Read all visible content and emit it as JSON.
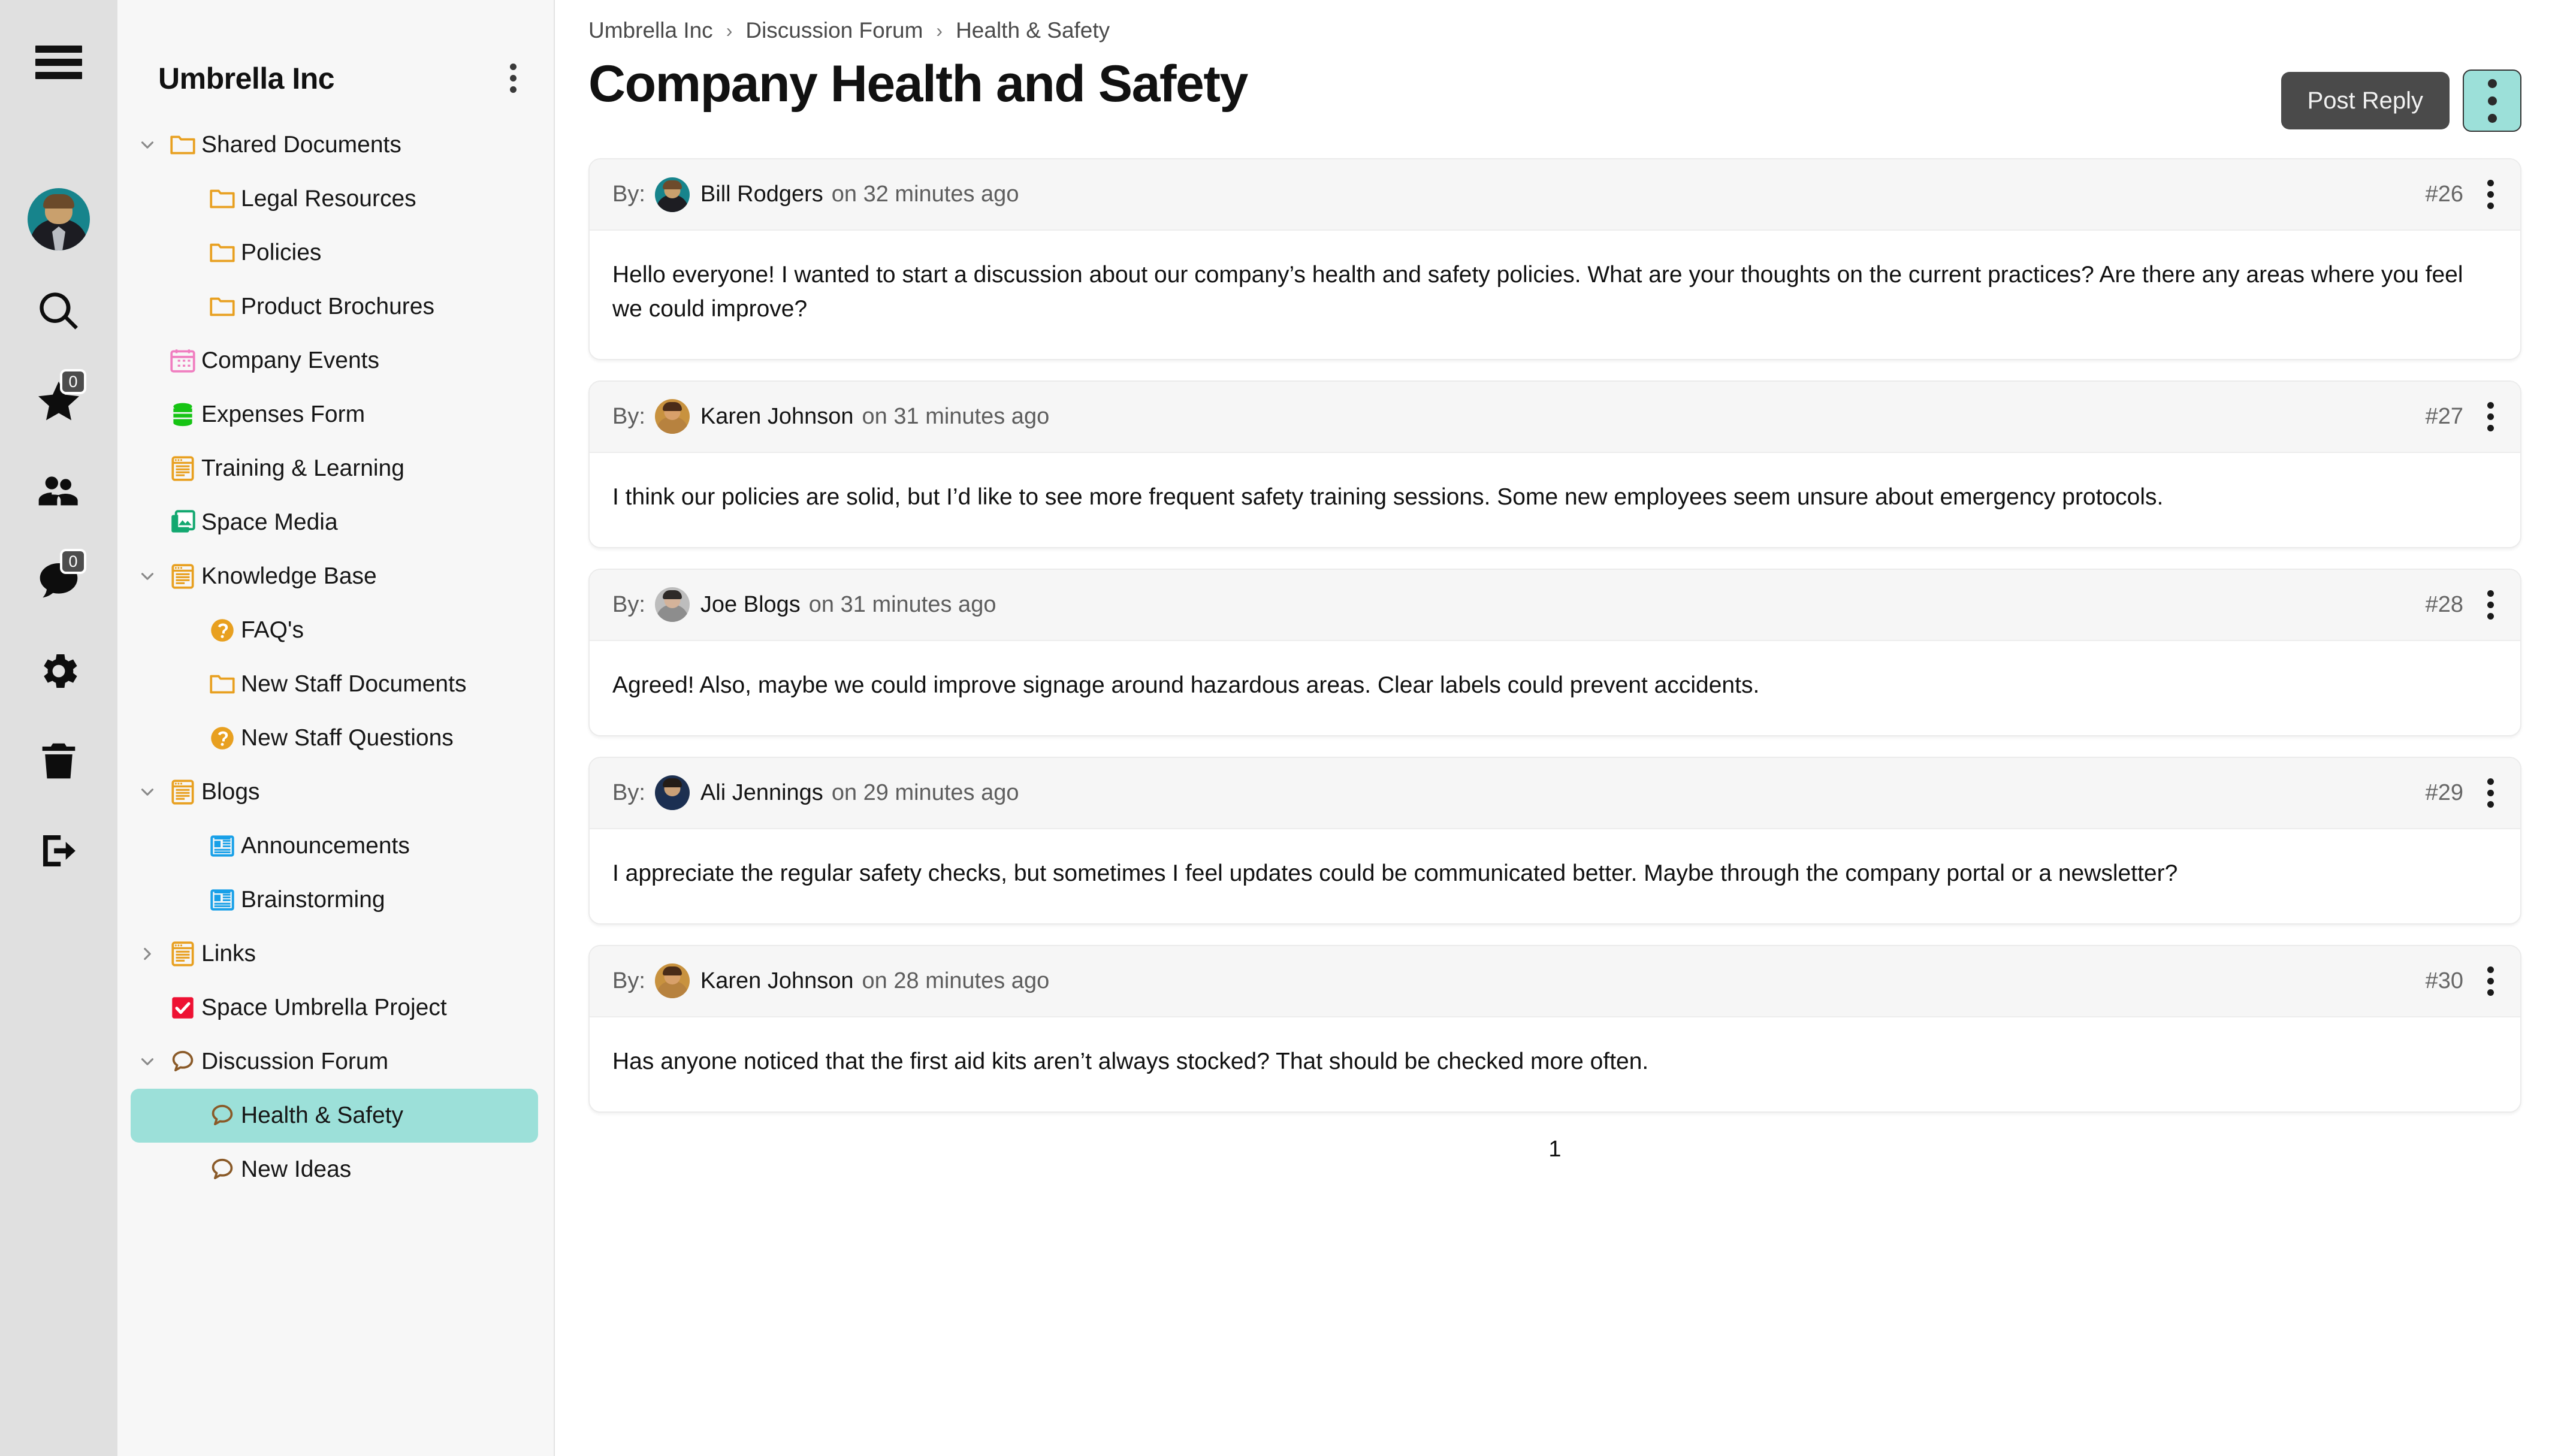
{
  "rail": {
    "menu_icon": "hamburger-menu-icon",
    "avatar_icon": "user-avatar",
    "items": [
      {
        "icon": "search-icon",
        "name": "search",
        "badge": null
      },
      {
        "icon": "star-icon",
        "name": "favourites",
        "badge": "0"
      },
      {
        "icon": "people-icon",
        "name": "people",
        "badge": null
      },
      {
        "icon": "chat-icon",
        "name": "messages",
        "badge": "0"
      },
      {
        "icon": "gear-icon",
        "name": "settings",
        "badge": null
      },
      {
        "icon": "trash-icon",
        "name": "trash",
        "badge": null
      },
      {
        "icon": "logout-icon",
        "name": "logout",
        "badge": null
      }
    ]
  },
  "sidebar": {
    "space_title": "Umbrella Inc",
    "more_icon": "kebab-menu-icon",
    "tree": [
      {
        "label": "Shared Documents",
        "icon": "folder-icon",
        "indent": 1,
        "twist": "down",
        "active": false
      },
      {
        "label": "Legal Resources",
        "icon": "folder-icon",
        "indent": 2,
        "twist": "none",
        "active": false
      },
      {
        "label": "Policies",
        "icon": "folder-icon",
        "indent": 2,
        "twist": "none",
        "active": false
      },
      {
        "label": "Product Brochures",
        "icon": "folder-icon",
        "indent": 2,
        "twist": "none",
        "active": false
      },
      {
        "label": "Company Events",
        "icon": "calendar-icon",
        "indent": 1,
        "twist": "none",
        "active": false
      },
      {
        "label": "Expenses Form",
        "icon": "database-icon",
        "indent": 1,
        "twist": "none",
        "active": false
      },
      {
        "label": "Training & Learning",
        "icon": "page-icon",
        "indent": 1,
        "twist": "none",
        "active": false
      },
      {
        "label": "Space Media",
        "icon": "image-icon",
        "indent": 1,
        "twist": "none",
        "active": false
      },
      {
        "label": "Knowledge Base",
        "icon": "page-icon",
        "indent": 1,
        "twist": "down",
        "active": false
      },
      {
        "label": "FAQ's",
        "icon": "question-icon",
        "indent": 2,
        "twist": "none",
        "active": false
      },
      {
        "label": "New Staff Documents",
        "icon": "folder-icon",
        "indent": 2,
        "twist": "none",
        "active": false
      },
      {
        "label": "New Staff Questions",
        "icon": "question-icon",
        "indent": 2,
        "twist": "none",
        "active": false
      },
      {
        "label": "Blogs",
        "icon": "page-icon",
        "indent": 1,
        "twist": "down",
        "active": false
      },
      {
        "label": "Announcements",
        "icon": "newspaper-icon",
        "indent": 2,
        "twist": "none",
        "active": false
      },
      {
        "label": "Brainstorming",
        "icon": "newspaper-icon",
        "indent": 2,
        "twist": "none",
        "active": false
      },
      {
        "label": "Links",
        "icon": "page-icon",
        "indent": 1,
        "twist": "right",
        "active": false
      },
      {
        "label": "Space Umbrella Project",
        "icon": "checkbox-icon",
        "indent": 1,
        "twist": "none",
        "active": false
      },
      {
        "label": "Discussion Forum",
        "icon": "speech-icon",
        "indent": 1,
        "twist": "down",
        "active": false
      },
      {
        "label": "Health & Safety",
        "icon": "speech-icon",
        "indent": 2,
        "twist": "none",
        "active": true
      },
      {
        "label": "New Ideas",
        "icon": "speech-icon",
        "indent": 2,
        "twist": "none",
        "active": false
      }
    ]
  },
  "header": {
    "breadcrumb": [
      "Umbrella Inc",
      "Discussion Forum",
      "Health & Safety"
    ],
    "separator": "›",
    "title": "Company Health and Safety",
    "post_reply_label": "Post Reply",
    "more_icon": "kebab-menu-icon"
  },
  "posts": {
    "by_label": "By:",
    "items": [
      {
        "author": "Bill Rodgers",
        "time": "on 32 minutes ago",
        "number": "#26",
        "body": "Hello everyone! I wanted to start a discussion about our company’s health and safety policies. What are your thoughts on the current practices? Are there any areas where you feel we could improve?",
        "avatar": {
          "skin": "#c9a06d",
          "hair": "#6d4b2c",
          "body": "#1d1d22",
          "bg": "#17848c"
        }
      },
      {
        "author": "Karen Johnson",
        "time": "on 31 minutes ago",
        "number": "#27",
        "body": "I think our policies are solid, but I’d like to see more frequent safety training sessions. Some new employees seem unsure about emergency protocols.",
        "avatar": {
          "skin": "#d8a06a",
          "hair": "#4a2c18",
          "body": "#b7823f",
          "bg": "#c8923f"
        }
      },
      {
        "author": "Joe Blogs",
        "time": "on 31 minutes ago",
        "number": "#28",
        "body": "Agreed! Also, maybe we could improve signage around hazardous areas. Clear labels could prevent accidents.",
        "avatar": {
          "skin": "#d4b39a",
          "hair": "#2e2a28",
          "body": "#8d8d8d",
          "bg": "#bdbdbd"
        }
      },
      {
        "author": "Ali Jennings",
        "time": "on 29 minutes ago",
        "number": "#29",
        "body": "I appreciate the regular safety checks, but sometimes I feel updates could be communicated better. Maybe through the company portal or a newsletter?",
        "avatar": {
          "skin": "#caa077",
          "hair": "#241c16",
          "body": "#1b2f52",
          "bg": "#1d3050"
        }
      },
      {
        "author": "Karen Johnson",
        "time": "on 28 minutes ago",
        "number": "#30",
        "body": "Has anyone noticed that the first aid kits aren’t always stocked? That should be checked more often.",
        "avatar": {
          "skin": "#d8a06a",
          "hair": "#4a2c18",
          "body": "#b7823f",
          "bg": "#c8923f"
        }
      }
    ],
    "post_menu_icon": "kebab-menu-icon"
  },
  "pagination": {
    "pages": [
      "1"
    ],
    "current": "1"
  },
  "colors": {
    "accent_teal": "#9ce0d9",
    "rail_bg": "#e0e0e0",
    "sidebar_bg": "#f7f7f7",
    "button_dark": "#4a4a4a",
    "folder_orange": "#e8a020",
    "calendar_pink": "#f07ec0",
    "database_green": "#16c414",
    "media_green": "#12a870",
    "newspaper_blue": "#18a0e8",
    "checkbox_red": "#ee1133",
    "speech_brown": "#8a5a28"
  }
}
